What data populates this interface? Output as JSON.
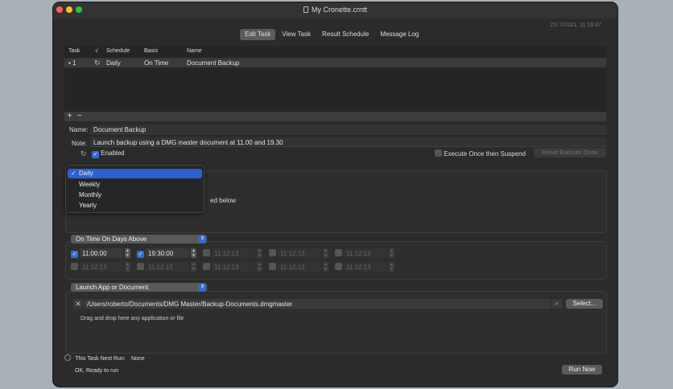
{
  "window": {
    "title": "My Cronette.crntt",
    "datetime": "21/ 7/2021, 11:16:47"
  },
  "tabs": [
    {
      "label": "Edit Task"
    },
    {
      "label": "View Task"
    },
    {
      "label": "Result Schedule"
    },
    {
      "label": "Message Log"
    }
  ],
  "table": {
    "headers": [
      "Task",
      "√",
      "Schedule",
      "Basis",
      "Name"
    ],
    "rows": [
      {
        "task": "• 1",
        "schedule": "Daily",
        "basis": "On Time",
        "name": "Document Backup"
      }
    ]
  },
  "form": {
    "name_label": "Name:",
    "name_value": "Document Backup",
    "note_label": "Note:",
    "note_value": "Launch backup using a DMG master document at 11.00 and 19.30",
    "enabled_label": "Enabled",
    "execute_once_label": "Execute Once then Suspend",
    "reset_label": "Reset Execute Once"
  },
  "schedule_menu": {
    "items": [
      "Daily",
      "Weekly",
      "Monthly",
      "Yearly"
    ],
    "selected": "Daily",
    "behind_text": "ed below"
  },
  "basis": {
    "popup": "On Time On Days Above",
    "times": [
      {
        "value": "11:00:00",
        "checked": true
      },
      {
        "value": "19:30:00",
        "checked": true
      },
      {
        "value": "11:12:13",
        "checked": false
      },
      {
        "value": "11:12:13",
        "checked": false
      },
      {
        "value": "11:12:13",
        "checked": false
      },
      {
        "value": "11:12:13",
        "checked": false
      },
      {
        "value": "11:12:13",
        "checked": false
      },
      {
        "value": "11:12:13",
        "checked": false
      },
      {
        "value": "11:12:13",
        "checked": false
      },
      {
        "value": "11:12:13",
        "checked": false
      }
    ]
  },
  "action": {
    "popup": "Launch App or Document",
    "path": "/Users/roberto/Documents/DMG Master/Backup-Documents.dmgmaster",
    "select_label": "Select...",
    "hint": "Drag and drop here any application or file"
  },
  "footer": {
    "next_run_label": "This Task Next Run:",
    "next_run_value": "None",
    "status": "OK, Ready to run",
    "run_now_label": "Run Now"
  },
  "colors": {
    "accent": "#2d6fdb",
    "window_bg": "#2b2b2b",
    "desktop_bg": "#a9b0b8"
  }
}
